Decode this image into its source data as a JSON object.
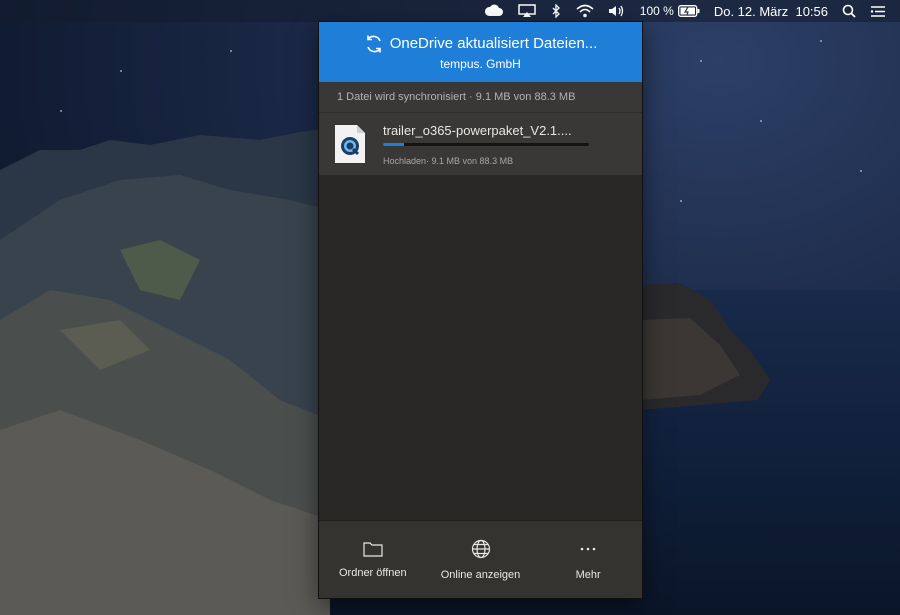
{
  "menubar": {
    "battery": "100 %",
    "clock": "Do. 12. März  10:56",
    "icons": [
      "onedrive-cloud-icon",
      "airplay-icon",
      "bluetooth-icon",
      "wifi-icon",
      "volume-icon",
      "battery-icon",
      "search-icon",
      "control-center-icon"
    ]
  },
  "onedrive": {
    "header_title": "OneDrive aktualisiert Dateien...",
    "header_subtitle": "tempus. GmbH",
    "sync_summary": "1 Datei wird synchronisiert · 9.1 MB von 88.3 MB",
    "file": {
      "name": "trailer_o365-powerpaket_V2.1....",
      "status": "Hochladen· 9.1 MB von 88.3 MB",
      "progress_fraction": 0.103,
      "icon": "quicktime-file-icon"
    },
    "footer": {
      "open_folder": "Ordner öffnen",
      "view_online": "Online anzeigen",
      "more": "Mehr"
    },
    "colors": {
      "accent": "#1f7fd8",
      "panel_bg": "#2a2826"
    }
  }
}
